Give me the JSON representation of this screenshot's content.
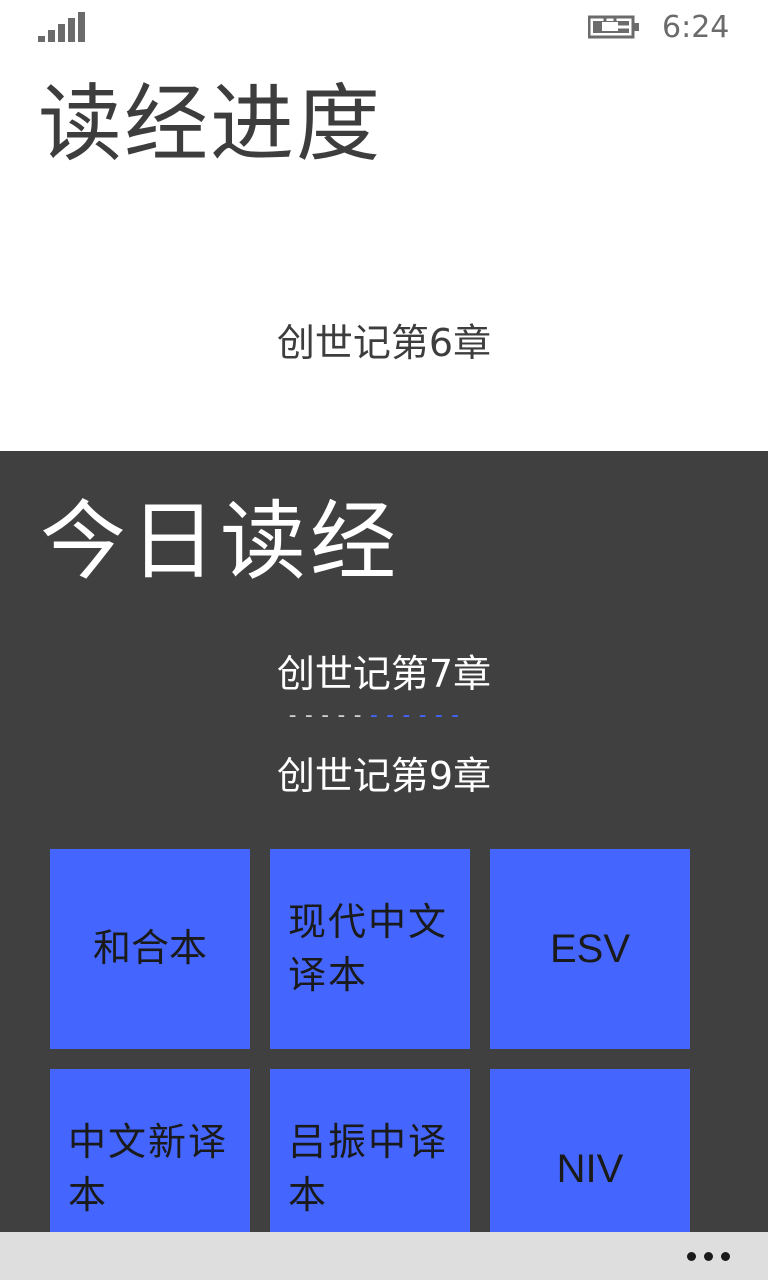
{
  "status_bar": {
    "time": "6:24",
    "signal_icon": "signal-bars-icon",
    "battery_icon": "battery-charging-icon"
  },
  "reading_progress": {
    "title": "读经进度",
    "current_chapter": "创世记第6章"
  },
  "today_reading": {
    "title": "今日读经",
    "start_chapter": "创世记第7章",
    "separator_gray": "-----",
    "separator_blue": "------",
    "end_chapter": "创世记第9章"
  },
  "versions": [
    {
      "label": "和合本"
    },
    {
      "label": "现代中文译本"
    },
    {
      "label": "ESV"
    },
    {
      "label": "中文新译本"
    },
    {
      "label": "吕振中译本"
    },
    {
      "label": "NIV"
    }
  ],
  "app_bar": {
    "more_icon": "ellipsis-icon"
  },
  "colors": {
    "accent": "#4466ff",
    "panel": "#404040",
    "app_bar": "#dedede",
    "text_dark": "#3d3d3d"
  }
}
